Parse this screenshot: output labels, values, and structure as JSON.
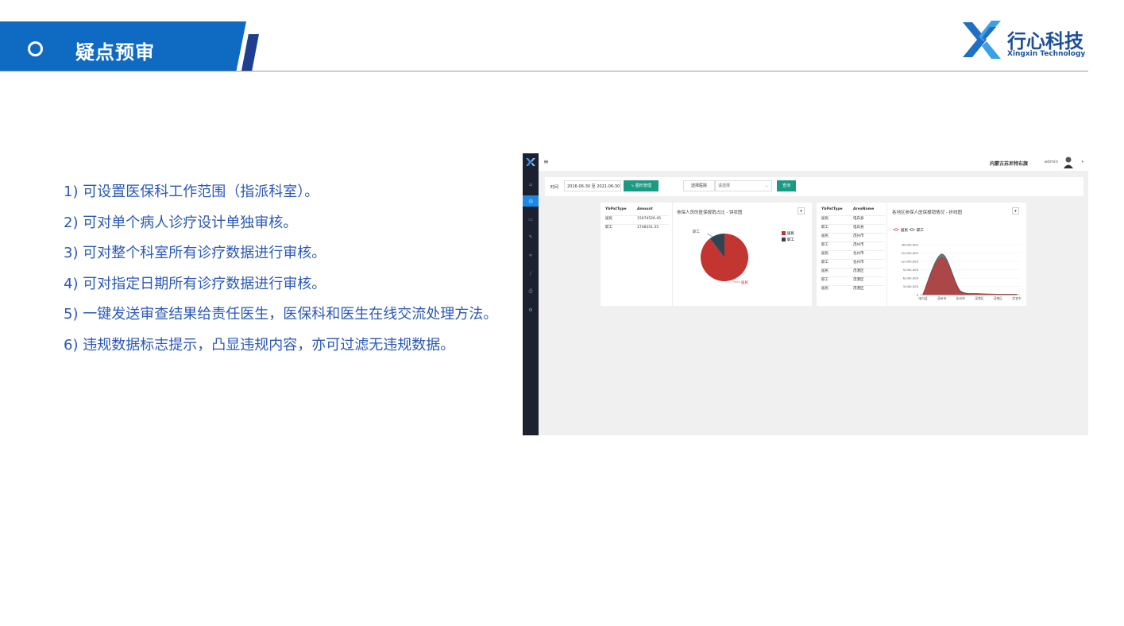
{
  "header": {
    "title": "疑点预审",
    "logo": {
      "name": "行心科技",
      "sub": "Xingxin Technology"
    }
  },
  "features": [
    "1) 可设置医保科工作范围（指派科室）。",
    "2) 可对单个病人诊疗设计单独审核。",
    "3) 可对整个科室所有诊疗数据进行审核。",
    "4) 可对指定日期所有诊疗数据进行审核。",
    "5) 一键发送审查结果给责任医生，医保科和医生在线交流处理方法。",
    "6) 违规数据标志提示，凸显违规内容，亦可过滤无违规数据。"
  ],
  "screenshot": {
    "topbar": {
      "region": "内蒙古苏尼特右旗",
      "user": "admin"
    },
    "filter": {
      "time_label": "时间",
      "date_range": "2016-06-30 至 2021-06-30",
      "chart_btn": "图形管理",
      "hospital_label": "选择医院",
      "hospital_placeholder": "请选择",
      "query_btn": "查询"
    },
    "panel1": {
      "columns": [
        "YbPatType",
        "Amount"
      ],
      "rows": [
        [
          "居民",
          "15074526.45"
        ],
        [
          "职工",
          "1748351.55"
        ]
      ],
      "title": "参保人员的医保报销占比 - 饼状图",
      "legend": [
        "居民",
        "职工"
      ],
      "colors": {
        "resident": "#c23531",
        "worker": "#2f4554"
      }
    },
    "panel2": {
      "columns": [
        "YbPatType",
        "AreaName"
      ],
      "rows": [
        [
          "居民",
          "电白县"
        ],
        [
          "职工",
          "电白县"
        ],
        [
          "居民",
          "茂州市"
        ],
        [
          "职工",
          "茂州市"
        ],
        [
          "居民",
          "化州市"
        ],
        [
          "职工",
          "化州市"
        ],
        [
          "居民",
          "茂港区"
        ],
        [
          "职工",
          "茂港区"
        ],
        [
          "居民",
          "茂港区"
        ]
      ],
      "title": "各地区参保人医保报销情况 - 折线图",
      "legend": [
        "居民",
        "职工"
      ],
      "yticks": [
        "18,000,000",
        "15,000,000",
        "12,000,000",
        "9,000,000",
        "6,000,000",
        "3,000,000",
        "0"
      ],
      "xticks": [
        "电白县",
        "茂州市",
        "化州市",
        "茂港区",
        "茂南区",
        "信宜市"
      ]
    }
  },
  "chart_data": [
    {
      "type": "pie",
      "title": "参保人员的医保报销占比 - 饼状图",
      "categories": [
        "居民",
        "职工"
      ],
      "values": [
        15074526.45,
        1748351.55
      ]
    },
    {
      "type": "area",
      "title": "各地区参保人医保报销情况 - 折线图",
      "categories": [
        "电白县",
        "茂州市",
        "化州市",
        "茂港区",
        "茂南区",
        "信宜市"
      ],
      "series": [
        {
          "name": "居民",
          "values": [
            200000,
            13500000,
            1000000,
            300000,
            150000,
            100000
          ]
        },
        {
          "name": "职工",
          "values": [
            100000,
            1100000,
            300000,
            100000,
            50000,
            50000
          ]
        }
      ],
      "ylim": [
        0,
        18000000
      ]
    }
  ]
}
